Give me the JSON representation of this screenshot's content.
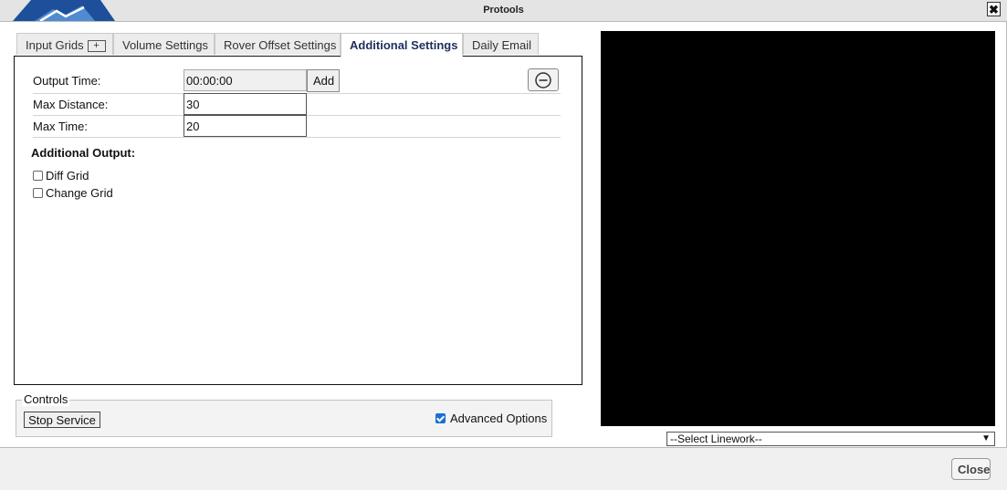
{
  "window": {
    "title": "Protools",
    "close_glyph": "✖"
  },
  "tabs": [
    {
      "label": "Input Grids",
      "add_glyph": "+"
    },
    {
      "label": "Volume Settings"
    },
    {
      "label": "Rover Offset Settings"
    },
    {
      "label": "Additional Settings",
      "active": true
    },
    {
      "label": "Daily Email"
    }
  ],
  "form": {
    "output_time_label": "Output Time:",
    "output_time_value": "00:00:00",
    "add_label": "Add",
    "remove_icon": "minus-circle-icon",
    "max_distance_label": "Max Distance:",
    "max_distance_value": "30",
    "max_time_label": "Max Time:",
    "max_time_value": "20",
    "additional_output_title": "Additional Output:",
    "options": [
      {
        "label": "Diff Grid",
        "checked": false
      },
      {
        "label": "Change Grid",
        "checked": false
      }
    ]
  },
  "controls": {
    "legend": "Controls",
    "stop_label": "Stop Service",
    "advanced_label": "Advanced Options",
    "advanced_checked": true
  },
  "linework": {
    "selected": "--Select Linework--"
  },
  "footer": {
    "close_label": "Close"
  },
  "colors": {
    "active_tab_text": "#1e2f5c",
    "logo_blue": "#1d4f9a",
    "checkbox_blue": "#1a6fd6"
  }
}
